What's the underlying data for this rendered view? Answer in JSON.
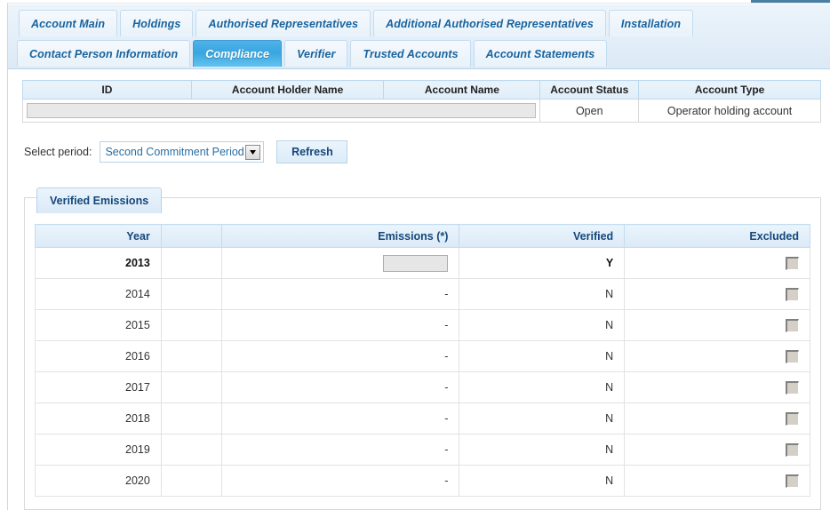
{
  "tabs": {
    "row1": [
      {
        "label": "Account Main",
        "active": false
      },
      {
        "label": "Holdings",
        "active": false
      },
      {
        "label": "Authorised Representatives",
        "active": false
      },
      {
        "label": "Additional Authorised Representatives",
        "active": false
      },
      {
        "label": "Installation",
        "active": false
      }
    ],
    "row2": [
      {
        "label": "Contact Person Information",
        "active": false
      },
      {
        "label": "Compliance",
        "active": true
      },
      {
        "label": "Verifier",
        "active": false
      },
      {
        "label": "Trusted Accounts",
        "active": false
      },
      {
        "label": "Account Statements",
        "active": false
      }
    ]
  },
  "account_table": {
    "headers": [
      "ID",
      "Account Holder Name",
      "Account Name",
      "Account Status",
      "Account Type"
    ],
    "row": {
      "id": "",
      "account_holder_name": "",
      "account_name": "",
      "account_status": "Open",
      "account_type": "Operator holding account"
    }
  },
  "period": {
    "label": "Select period:",
    "selected": "Second Commitment Period",
    "refresh_label": "Refresh"
  },
  "verified_emissions": {
    "legend": "Verified Emissions",
    "headers": [
      "Year",
      "",
      "Emissions (*)",
      "Verified",
      "Excluded"
    ],
    "rows": [
      {
        "year": "2013",
        "blank": "",
        "emissions": "",
        "verified": "Y",
        "excluded": false,
        "current": true
      },
      {
        "year": "2014",
        "blank": "",
        "emissions": "-",
        "verified": "N",
        "excluded": false,
        "current": false
      },
      {
        "year": "2015",
        "blank": "",
        "emissions": "-",
        "verified": "N",
        "excluded": false,
        "current": false
      },
      {
        "year": "2016",
        "blank": "",
        "emissions": "-",
        "verified": "N",
        "excluded": false,
        "current": false
      },
      {
        "year": "2017",
        "blank": "",
        "emissions": "-",
        "verified": "N",
        "excluded": false,
        "current": false
      },
      {
        "year": "2018",
        "blank": "",
        "emissions": "-",
        "verified": "N",
        "excluded": false,
        "current": false
      },
      {
        "year": "2019",
        "blank": "",
        "emissions": "-",
        "verified": "N",
        "excluded": false,
        "current": false
      },
      {
        "year": "2020",
        "blank": "",
        "emissions": "-",
        "verified": "N",
        "excluded": false,
        "current": false
      }
    ]
  },
  "colors": {
    "tab_text": "#18639e",
    "active_tab_bg": "#39a5e0",
    "header_text": "#14477a",
    "panel_border": "#b9d3e8"
  }
}
